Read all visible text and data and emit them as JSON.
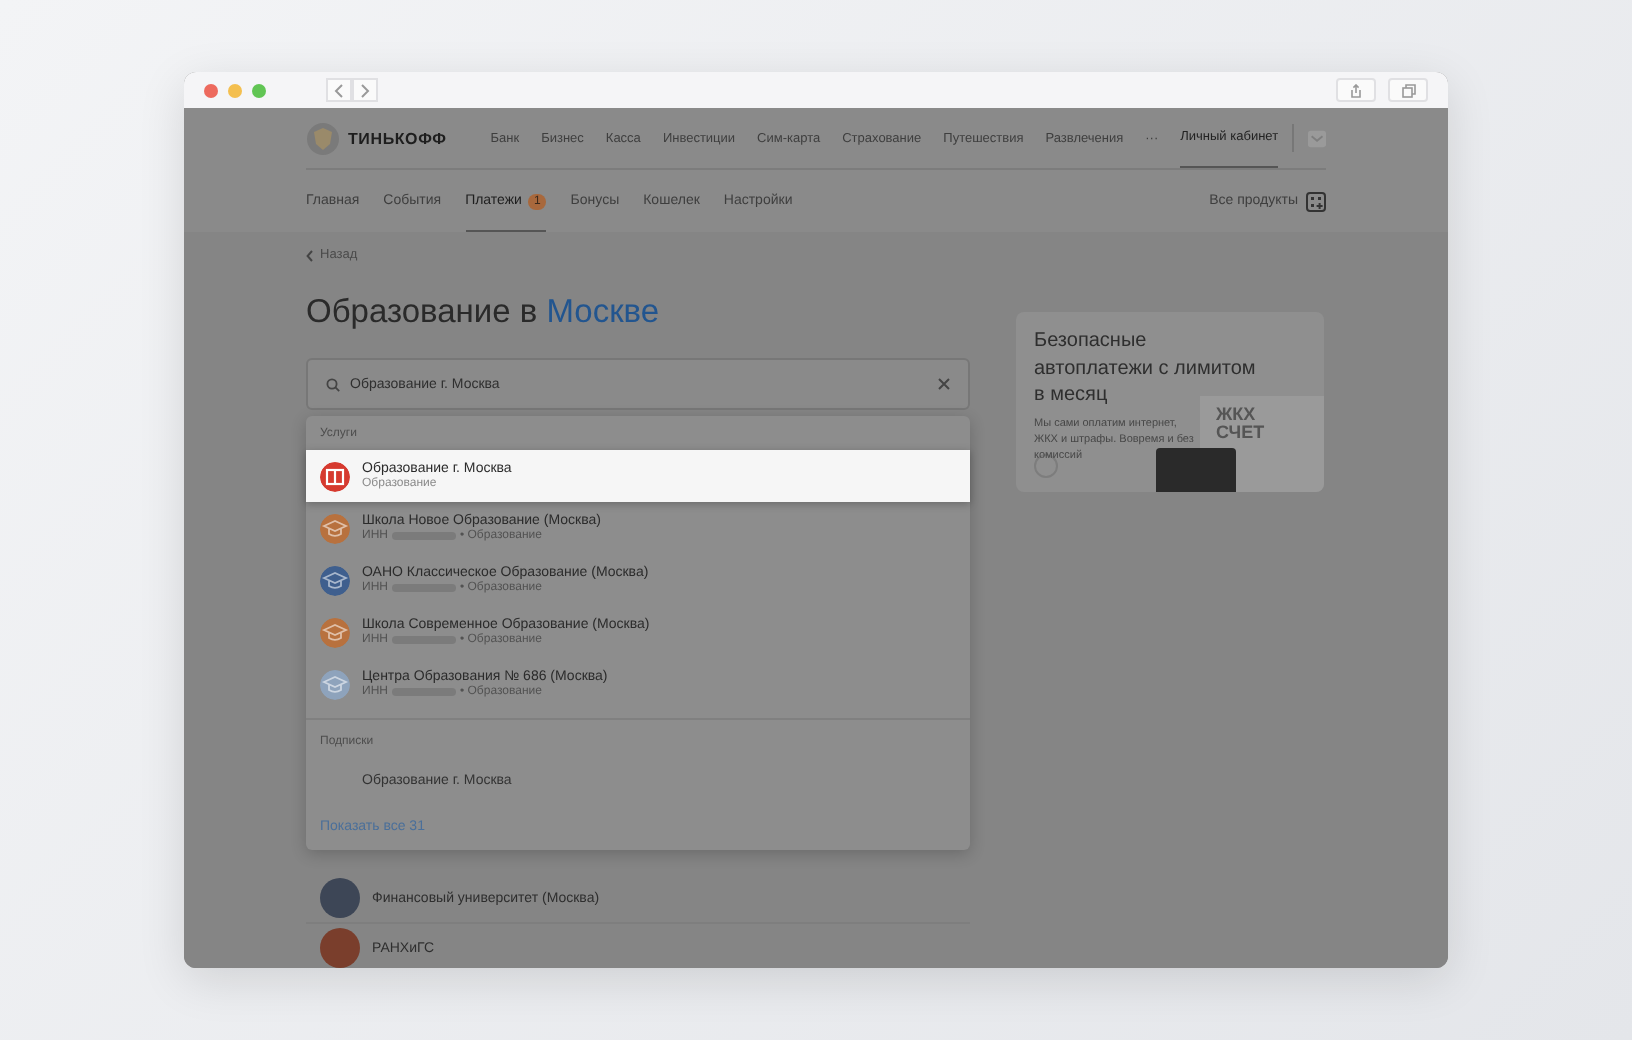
{
  "header": {
    "logo": "ТИНЬКОФФ",
    "nav": [
      "Банк",
      "Бизнес",
      "Касса",
      "Инвестиции",
      "Сим-карта",
      "Страхование",
      "Путешествия",
      "Развлечения"
    ],
    "more": "···",
    "account": {
      "label": "Личный кабинет",
      "selected": true
    }
  },
  "tabs": [
    {
      "label": "Главная",
      "selected": false
    },
    {
      "label": "События",
      "selected": false
    },
    {
      "label": "Платежи",
      "selected": true,
      "badge": "1"
    },
    {
      "label": "Бонусы",
      "selected": false
    },
    {
      "label": "Кошелек",
      "selected": false
    },
    {
      "label": "Настройки",
      "selected": false
    }
  ],
  "all_products": "Все продукты",
  "back": "Назад",
  "title": {
    "plain": "Образование в",
    "accent": "Москве"
  },
  "search": {
    "value": "Образование г. Москва"
  },
  "dropdown": {
    "services_heading": "Услуги",
    "services": [
      {
        "kind": "book",
        "title": "Образование г. Москва",
        "meta": "Образование",
        "selected": true,
        "color": "#d63a2f"
      },
      {
        "kind": "cap",
        "title": "Школа Новое Образование (Москва)",
        "prefix": "ИНН",
        "meta": "• Образование",
        "selected": false,
        "color": "#b8713e"
      },
      {
        "kind": "cap",
        "title": "ОАНО Классическое Образование (Москва)",
        "prefix": "ИНН",
        "meta": "• Образование",
        "selected": false,
        "color": "#3f5f8e"
      },
      {
        "kind": "cap",
        "title": "Школа Современное Образование (Москва)",
        "prefix": "ИНН",
        "meta": "• Образование",
        "selected": false,
        "color": "#b8713e"
      },
      {
        "kind": "cap",
        "title": "Центра Образования № 686 (Москва)",
        "prefix": "ИНН",
        "meta": "• Образование",
        "selected": false,
        "color": "#8ea3bc"
      }
    ],
    "subscriptions_heading": "Подписки",
    "subscriptions": [
      "Образование г. Москва"
    ],
    "show_all": "Показать все 31"
  },
  "list": [
    {
      "name": "Финансовый университет (Москва)",
      "color": "#3d4656"
    },
    {
      "name": "РАНХиГС",
      "color": "#7a3e2c"
    }
  ],
  "promo": {
    "title": "Безопасные автоплатежи с лимитом в месяц",
    "text": "Мы сами оплатим интернет, ЖКХ и штрафы. Вовремя и без комиссий",
    "bill": [
      "ЖКХ",
      "СЧЕТ"
    ]
  }
}
